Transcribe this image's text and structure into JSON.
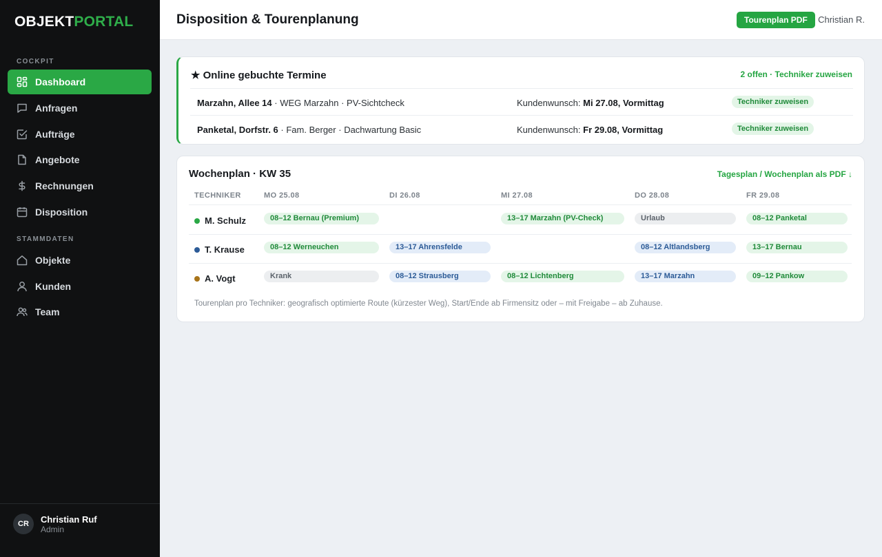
{
  "app": {
    "logo_part1": "OBJEKT",
    "logo_part2": "PORTAL"
  },
  "sidebar": {
    "sections": [
      {
        "label": "COCKPIT",
        "items": [
          {
            "label": "Dashboard",
            "icon": "dashboard-icon",
            "active": true
          },
          {
            "label": "Anfragen",
            "icon": "message-icon"
          },
          {
            "label": "Aufträge",
            "icon": "checkbox-icon"
          },
          {
            "label": "Angebote",
            "icon": "document-icon"
          },
          {
            "label": "Rechnungen",
            "icon": "dollar-icon"
          },
          {
            "label": "Disposition",
            "icon": "calendar-icon"
          }
        ]
      },
      {
        "label": "STAMMDATEN",
        "items": [
          {
            "label": "Objekte",
            "icon": "home-icon"
          },
          {
            "label": "Kunden",
            "icon": "user-icon"
          },
          {
            "label": "Team",
            "icon": "team-icon"
          }
        ]
      }
    ],
    "user": {
      "initials": "CR",
      "name": "Christian Ruf",
      "role": "Admin"
    }
  },
  "header": {
    "title": "Disposition & Tourenplanung",
    "pdf_button": "Tourenplan PDF",
    "user": "Christian R."
  },
  "online_bookings": {
    "title": "★ Online gebuchte Termine",
    "summary_link": "2 offen · Techniker zuweisen",
    "rows": [
      {
        "place": "Marzahn, Allee 14",
        "customer": "WEG Marzahn",
        "service": "PV-Sichtcheck",
        "wish_label": "Kundenwunsch:",
        "wish": "Mi 27.08, Vormittag",
        "action": "Techniker zuweisen"
      },
      {
        "place": "Panketal, Dorfstr. 6",
        "customer": "Fam. Berger",
        "service": "Dachwartung Basic",
        "wish_label": "Kundenwunsch:",
        "wish": "Fr 29.08, Vormittag",
        "action": "Techniker zuweisen"
      }
    ]
  },
  "weekplan": {
    "title": "Wochenplan · KW 35",
    "pdf_link": "Tagesplan / Wochenplan als PDF ↓",
    "columns": [
      "TECHNIKER",
      "MO 25.08",
      "DI 26.08",
      "MI 27.08",
      "DO 28.08",
      "FR 29.08"
    ],
    "rows": [
      {
        "tech": "M. Schulz",
        "color": "#2aa845",
        "slots": [
          {
            "text": "08–12 Bernau (Premium)",
            "style": "green"
          },
          null,
          {
            "text": "13–17 Marzahn (PV-Check)",
            "style": "green"
          },
          {
            "text": "Urlaub",
            "style": "gray"
          },
          {
            "text": "08–12 Panketal",
            "style": "green"
          }
        ]
      },
      {
        "tech": "T. Krause",
        "color": "#2c5b97",
        "slots": [
          {
            "text": "08–12 Werneuchen",
            "style": "green"
          },
          {
            "text": "13–17 Ahrensfelde",
            "style": "blue"
          },
          null,
          {
            "text": "08–12 Altlandsberg",
            "style": "blue"
          },
          {
            "text": "13–17 Bernau",
            "style": "green"
          }
        ]
      },
      {
        "tech": "A. Vogt",
        "color": "#a8741a",
        "slots": [
          {
            "text": "Krank",
            "style": "gray"
          },
          {
            "text": "08–12 Strausberg",
            "style": "blue"
          },
          {
            "text": "08–12 Lichtenberg",
            "style": "green"
          },
          {
            "text": "13–17 Marzahn",
            "style": "blue"
          },
          {
            "text": "09–12 Pankow",
            "style": "green"
          }
        ]
      }
    ],
    "footnote": "Tourenplan pro Techniker: geografisch optimierte Route (kürzester Weg), Start/Ende ab Firmensitz oder – mit Freigabe – ab Zuhause."
  }
}
